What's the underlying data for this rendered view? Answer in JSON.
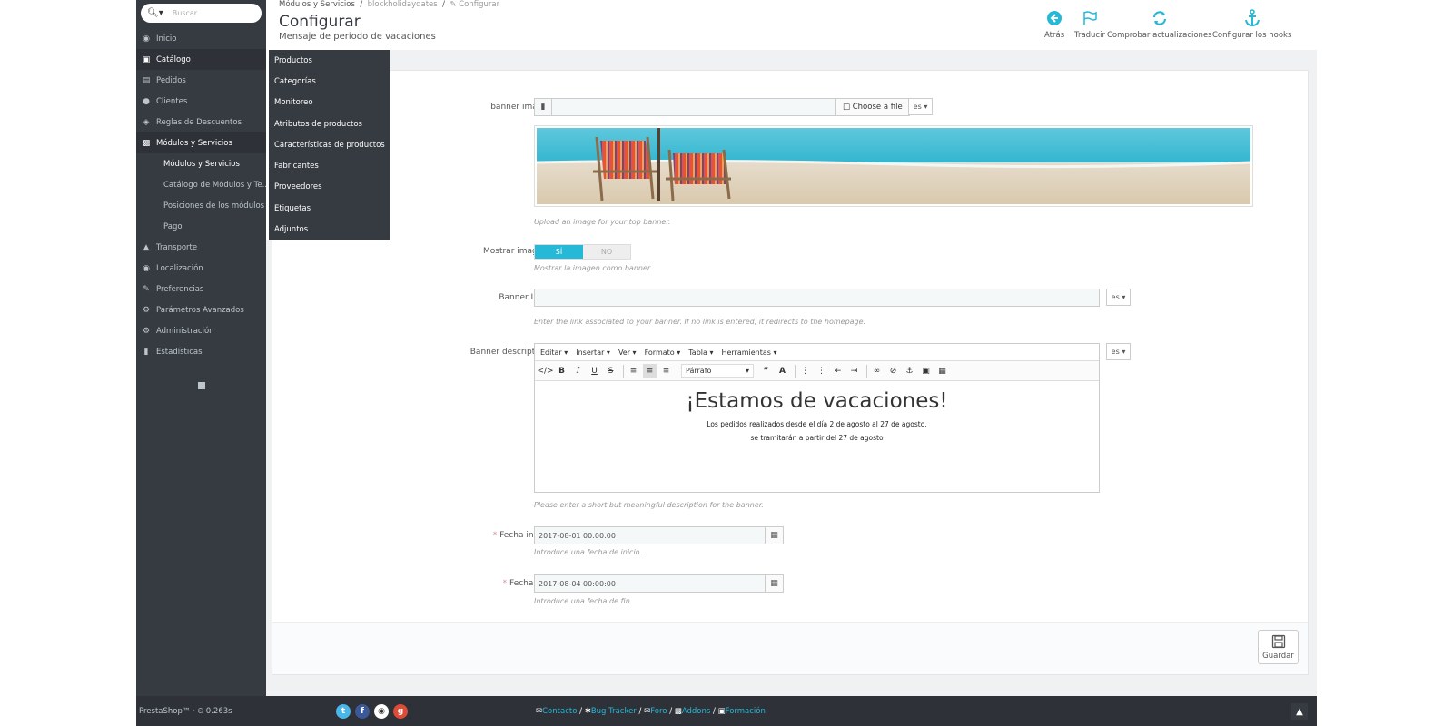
{
  "search": {
    "placeholder": "Buscar"
  },
  "sidebar": {
    "items": [
      {
        "label": "Inicio",
        "icon": "dashboard-icon"
      },
      {
        "label": "Catálogo",
        "icon": "book-icon"
      },
      {
        "label": "Pedidos",
        "icon": "credit-card-icon"
      },
      {
        "label": "Clientes",
        "icon": "users-icon"
      },
      {
        "label": "Reglas de Descuentos",
        "icon": "tags-icon"
      },
      {
        "label": "Módulos y Servicios",
        "icon": "puzzle-icon"
      },
      {
        "label": "Transporte",
        "icon": "truck-icon"
      },
      {
        "label": "Localización",
        "icon": "globe-icon"
      },
      {
        "label": "Preferencias",
        "icon": "wrench-icon"
      },
      {
        "label": "Parámetros Avanzados",
        "icon": "cogs-icon"
      },
      {
        "label": "Administración",
        "icon": "cog-icon"
      },
      {
        "label": "Estadísticas",
        "icon": "bar-chart-icon"
      }
    ],
    "subitems": [
      "Módulos y Servicios",
      "Catálogo de Módulos y Te...",
      "Posiciones de los módulos",
      "Pago"
    ]
  },
  "flyout": {
    "items": [
      "Productos",
      "Categorías",
      "Monitoreo",
      "Atributos de productos",
      "Características de productos",
      "Fabricantes",
      "Proveedores",
      "Etiquetas",
      "Adjuntos"
    ]
  },
  "header": {
    "breadcrumb": {
      "first": "Módulos y Servicios",
      "second": "blockholidaydates",
      "third": "Configurar"
    },
    "title": "Configurar",
    "subtitle": "Mensaje de periodo de vacaciones",
    "toolbar": [
      "Atrás",
      "Traducir",
      "Comprobar actualizaciones",
      "Configurar los hooks"
    ]
  },
  "form": {
    "banner_image": {
      "label": "banner image",
      "button": "Choose a file",
      "lang": "es",
      "help": "Upload an image for your top banner."
    },
    "show_image": {
      "label": "Mostrar imagen",
      "yes": "SÍ",
      "no": "NO",
      "help": "Mostrar la imagen como banner"
    },
    "banner_link": {
      "label": "Banner Link",
      "value": "",
      "lang": "es",
      "help": "Enter the link associated to your banner. If no link is entered, it redirects to the homepage."
    },
    "banner_description": {
      "label": "Banner description",
      "lang": "es",
      "menus": [
        "Editar",
        "Insertar",
        "Ver",
        "Formato",
        "Tabla",
        "Herramientas"
      ],
      "format_select": "Párrafo",
      "heading": "¡Estamos de vacaciones!",
      "line1": "Los pedidos realizados desde el día 2 de agosto al 27 de agosto,",
      "line2": "se tramitarán a partir del 27 de agosto",
      "help": "Please enter a short but meaningful description for the banner."
    },
    "start_date": {
      "label": "Fecha inicio",
      "required": "*",
      "value": "2017-08-01 00:00:00",
      "help": "Introduce una fecha de inicio."
    },
    "end_date": {
      "label": "Fecha Fin",
      "required": "*",
      "value": "2017-08-04 00:00:00",
      "help": "Introduce una fecha de fin."
    },
    "save_label": "Guardar"
  },
  "footer": {
    "brand": "PrestaShop™ · ⏲ 0.263s",
    "links": [
      "Contacto",
      "Bug Tracker",
      "Foro",
      "Addons",
      "Formación"
    ],
    "social": [
      "twitter-icon",
      "facebook-icon",
      "github-icon",
      "google-plus-icon"
    ]
  },
  "colors": {
    "accent": "#25b9d7",
    "sidebar": "#363a41",
    "footer": "#2e3138"
  }
}
